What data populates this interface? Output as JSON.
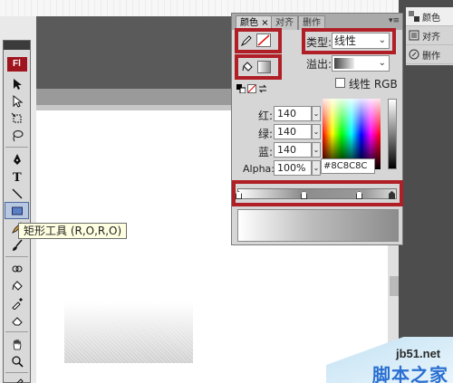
{
  "tools_panel": {
    "logo": "Fl",
    "tools": [
      "arrow-icon",
      "subselect-icon",
      "free-transform-icon",
      "lasso-icon",
      "pen-icon",
      "text-icon",
      "line-icon",
      "rectangle-icon",
      "pencil-icon",
      "brush-icon",
      "deco-icon",
      "bone-icon",
      "paint-bucket-icon",
      "eyedropper-icon",
      "eraser-icon",
      "hand-icon",
      "zoom-icon",
      "stroke-pencil-icon"
    ],
    "active_tool": "rectangle-icon"
  },
  "tooltip": {
    "text": "矩形工具 (R,O,R,O)"
  },
  "color_panel": {
    "tabs": [
      "颜色",
      "对齐",
      "删作"
    ],
    "tab_close": "×",
    "menu": "▾≡",
    "type_label": "类型:",
    "type_value": "线性",
    "overflow_label": "溢出:",
    "linear_rgb_label": "线性 RGB",
    "red_label": "红:",
    "red_value": "140",
    "green_label": "绿:",
    "green_value": "140",
    "blue_label": "蓝:",
    "blue_value": "140",
    "alpha_label": "Alpha:",
    "alpha_value": "100%",
    "hex_value": "#8C8C8C",
    "dropdown_arrow": "⌄",
    "spin_arrow": "⌄",
    "stroke_color_icon": "pencil-icon",
    "fill_color_icon": "paint-bucket-icon",
    "highlight_color": "#b01e26"
  },
  "side_panel": {
    "items": [
      {
        "label": "颜色",
        "icon": "color-palette-icon"
      },
      {
        "label": "对齐",
        "icon": "align-icon"
      },
      {
        "label": "删作",
        "icon": "transform-icon"
      }
    ]
  },
  "watermark": {
    "url": "jb51.net",
    "name": "脚本之家"
  }
}
